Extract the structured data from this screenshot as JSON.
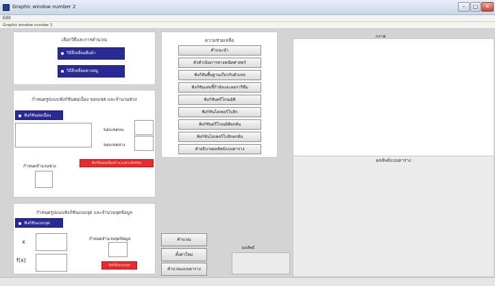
{
  "window": {
    "title": "Graphic window number 2",
    "menu_edit": "Edit",
    "subtitle": "Graphic window number 2",
    "minimize_glyph": "–",
    "maximize_glyph": "□",
    "close_glyph": "✕"
  },
  "method_panel": {
    "title": "เลือกวิธีและการคำนวณ",
    "option1": "วิธีสี่เหลี่ยมผืนผ้า",
    "option2": "วิธีสี่เหลี่ยมคางหมู"
  },
  "limits_panel": {
    "title": "กำหนดรูปแบบฟังก์ชันต่อเนื่อง ขอบเขต และจำนวนช่วง",
    "radio": "ฟังก์ชันต่อเนื่อง",
    "upper_label": "ขอบเขตบน",
    "lower_label": "ขอบเขตล่าง",
    "intervals_label": "กำหนดจำนวนช่วง",
    "red_button": "ฟังก์ชันต่อเนื่องจำนวนช่วงฟังก์ชัน"
  },
  "discrete_panel": {
    "title": "กำหนดรูปแบบฟังก์ชันแบบจุด และจำนวนจุดข้อมูล",
    "radio": "ฟังก์ชันแบบจุด",
    "x_label": "x",
    "fx_label": "f(x)",
    "points_label": "กำหนดจำนวนจุดข้อมูล",
    "red_button": "ฟังก์ชันแบบจุด"
  },
  "help_panel": {
    "title": "ความช่วยเหลือ",
    "buttons": [
      "คำแนะนำ",
      "ตัวดำเนินการทางคณิตศาสตร์",
      "ฟังก์ชันพื้นฐานเกี่ยวกับตัวเลข",
      "ฟังก์ชันเลขชี้กำลังและลอการิทึม",
      "ฟังก์ชันตรีโกณมิติ",
      "ฟังก์ชันไฮเพอร์โบลิก",
      "ฟังก์ชันตรีโกณมิติผกผัน",
      "ฟังก์ชันไฮเพอร์โบลิกผกผัน",
      "คำอธิบายผลลัพธ์แบบตาราง"
    ]
  },
  "actions": {
    "calculate": "คำนวณ",
    "reset": "ตั้งค่าใหม่",
    "table": "คำนวณแบบตาราง",
    "result_label": "ผลลัพธ์"
  },
  "graph_panel": {
    "title": "กราฟ"
  },
  "table_panel": {
    "title": "ผลลัพธ์แบบตาราง"
  }
}
